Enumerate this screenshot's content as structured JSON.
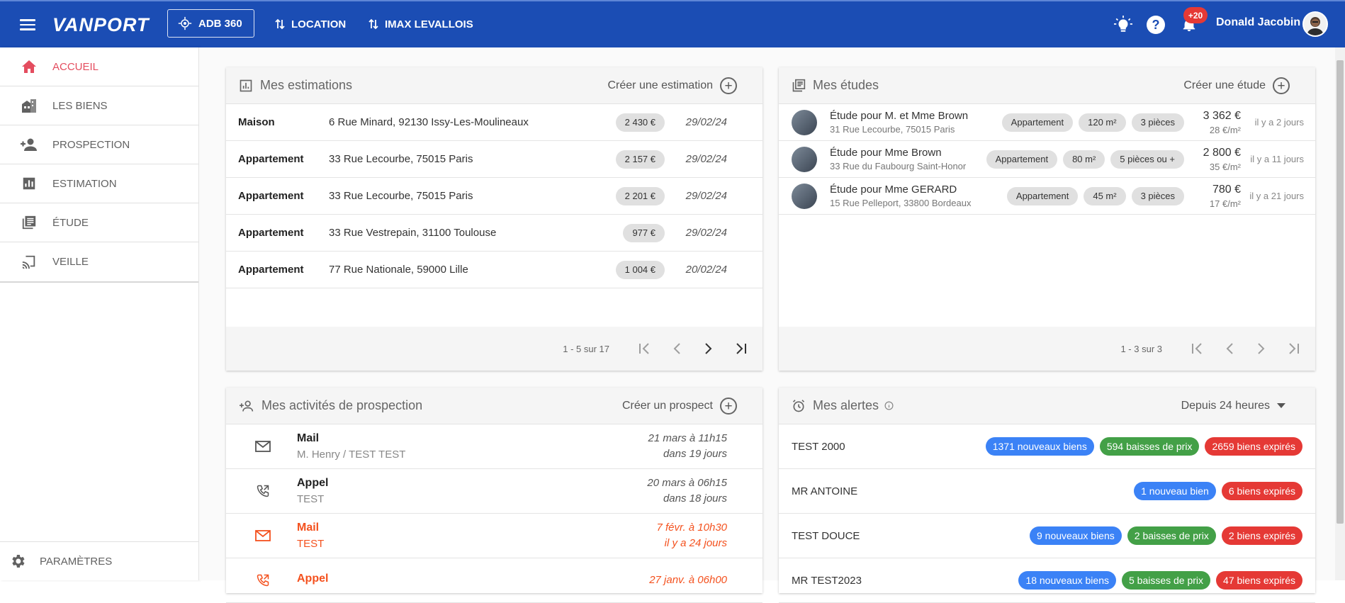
{
  "header": {
    "logo": "VANPORT",
    "adb_label": "ADB 360",
    "location_label": "LOCATION",
    "imax_label": "IMAX LEVALLOIS",
    "notification_badge": "+20",
    "help": "?",
    "user_name": "Donald Jacobin"
  },
  "sidebar": {
    "items": [
      {
        "label": "ACCUEIL",
        "icon": "home-icon"
      },
      {
        "label": "LES BIENS",
        "icon": "buildings-icon"
      },
      {
        "label": "PROSPECTION",
        "icon": "person-add-icon"
      },
      {
        "label": "ESTIMATION",
        "icon": "bar-chart-icon"
      },
      {
        "label": "ÉTUDE",
        "icon": "library-icon"
      },
      {
        "label": "VEILLE",
        "icon": "cast-icon"
      }
    ],
    "settings_label": "PARAMÈTRES"
  },
  "estimations": {
    "title": "Mes estimations",
    "action": "Créer une estimation",
    "rows": [
      {
        "type": "Maison",
        "address": "6 Rue Minard, 92130 Issy-Les-Moulineaux",
        "price": "2 430 €",
        "date": "29/02/24"
      },
      {
        "type": "Appartement",
        "address": "33 Rue Lecourbe, 75015 Paris",
        "price": "2 157 €",
        "date": "29/02/24"
      },
      {
        "type": "Appartement",
        "address": "33 Rue Lecourbe, 75015 Paris",
        "price": "2 201 €",
        "date": "29/02/24"
      },
      {
        "type": "Appartement",
        "address": "33 Rue Vestrepain, 31100 Toulouse",
        "price": "977 €",
        "date": "29/02/24"
      },
      {
        "type": "Appartement",
        "address": "77 Rue Nationale, 59000 Lille",
        "price": "1 004 €",
        "date": "20/02/24"
      }
    ],
    "pagination": "1 - 5 sur 17"
  },
  "etudes": {
    "title": "Mes études",
    "action": "Créer une étude",
    "rows": [
      {
        "name": "Étude pour M. et Mme Brown",
        "address": "31 Rue Lecourbe, 75015 Paris",
        "chips": [
          "Appartement",
          "120 m²",
          "3 pièces"
        ],
        "price": "3 362 €",
        "ppm": "28 €/m²",
        "ago": "il y a 2 jours"
      },
      {
        "name": "Étude pour Mme Brown",
        "address": "33 Rue du Faubourg Saint-Honor",
        "chips": [
          "Appartement",
          "80 m²",
          "5 pièces ou +"
        ],
        "price": "2 800 €",
        "ppm": "35 €/m²",
        "ago": "il y a 11 jours"
      },
      {
        "name": "Étude pour Mme GERARD",
        "address": "15 Rue Pelleport, 33800 Bordeaux",
        "chips": [
          "Appartement",
          "45 m²",
          "3 pièces"
        ],
        "price": "780 €",
        "ppm": "17 €/m²",
        "ago": "il y a 21 jours"
      }
    ],
    "pagination": "1 - 3 sur 3"
  },
  "activites": {
    "title": "Mes activités de prospection",
    "action": "Créer un prospect",
    "rows": [
      {
        "kind": "mail",
        "type": "Mail",
        "who": "M. Henry / TEST TEST",
        "date": "21 mars à 11h15",
        "rel": "dans 19 jours",
        "late": false
      },
      {
        "kind": "phone",
        "type": "Appel",
        "who": "TEST",
        "date": "20 mars à 06h15",
        "rel": "dans 18 jours",
        "late": false
      },
      {
        "kind": "mail",
        "type": "Mail",
        "who": "TEST",
        "date": "7 févr. à 10h30",
        "rel": "il y a 24 jours",
        "late": true
      },
      {
        "kind": "phone",
        "type": "Appel",
        "who": "",
        "date": "27 janv. à 06h00",
        "rel": "",
        "late": true
      }
    ]
  },
  "alertes": {
    "title": "Mes alertes",
    "filter": "Depuis 24 heures",
    "rows": [
      {
        "name": "TEST 2000",
        "chips": [
          {
            "text": "1371 nouveaux biens",
            "color": "blue"
          },
          {
            "text": "594 baisses de prix",
            "color": "green"
          },
          {
            "text": "2659 biens expirés",
            "color": "red"
          }
        ]
      },
      {
        "name": "MR ANTOINE",
        "chips": [
          {
            "text": "1 nouveau bien",
            "color": "blue"
          },
          {
            "text": "6 biens expirés",
            "color": "red"
          }
        ]
      },
      {
        "name": "TEST DOUCE",
        "chips": [
          {
            "text": "9 nouveaux biens",
            "color": "blue"
          },
          {
            "text": "2 baisses de prix",
            "color": "green"
          },
          {
            "text": "2 biens expirés",
            "color": "red"
          }
        ]
      },
      {
        "name": "MR TEST2023",
        "chips": [
          {
            "text": "18 nouveaux biens",
            "color": "blue"
          },
          {
            "text": "5 baisses de prix",
            "color": "green"
          },
          {
            "text": "47 biens expirés",
            "color": "red"
          }
        ]
      }
    ]
  },
  "colors": {
    "header_bg": "#1b4db4",
    "accent_red": "#e44d5f",
    "late_orange": "#f4511e",
    "chip_blue": "#3b82f6",
    "chip_green": "#43a047",
    "chip_red": "#e53935"
  }
}
